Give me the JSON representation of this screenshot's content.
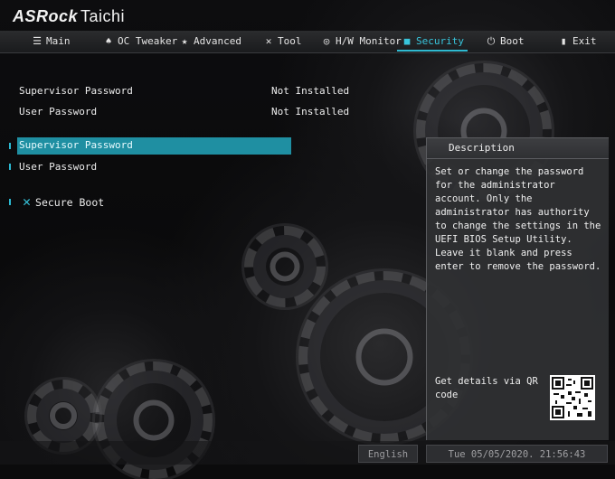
{
  "brand": {
    "name": "ASRock",
    "model": "Taichi"
  },
  "tabs": [
    {
      "label": "Main",
      "icon": "list-icon"
    },
    {
      "label": "OC Tweaker",
      "icon": "flame-icon"
    },
    {
      "label": "Advanced",
      "icon": "star-icon"
    },
    {
      "label": "Tool",
      "icon": "tools-icon"
    },
    {
      "label": "H/W Monitor",
      "icon": "monitor-icon"
    },
    {
      "label": "Security",
      "icon": "shield-icon",
      "active": true
    },
    {
      "label": "Boot",
      "icon": "power-icon"
    },
    {
      "label": "Exit",
      "icon": "exit-icon"
    }
  ],
  "status_items": [
    {
      "label": "Supervisor Password",
      "value": "Not Installed"
    },
    {
      "label": "User Password",
      "value": "Not Installed"
    }
  ],
  "menu": {
    "supervisor_password": "Supervisor Password",
    "user_password": "User Password",
    "secure_boot": "Secure Boot"
  },
  "description": {
    "title": "Description",
    "text": "Set or change the password for the administrator account. Only the administrator has authority to change the settings in the UEFI BIOS Setup Utility. Leave it blank and press enter to remove the password.",
    "qr_label": "Get details via QR code"
  },
  "footer": {
    "language": "English",
    "datetime": "Tue 05/05/2020. 21:56:43"
  },
  "colors": {
    "accent": "#2fb9d0",
    "selection": "#1f8fa2",
    "panel": "#303133"
  }
}
